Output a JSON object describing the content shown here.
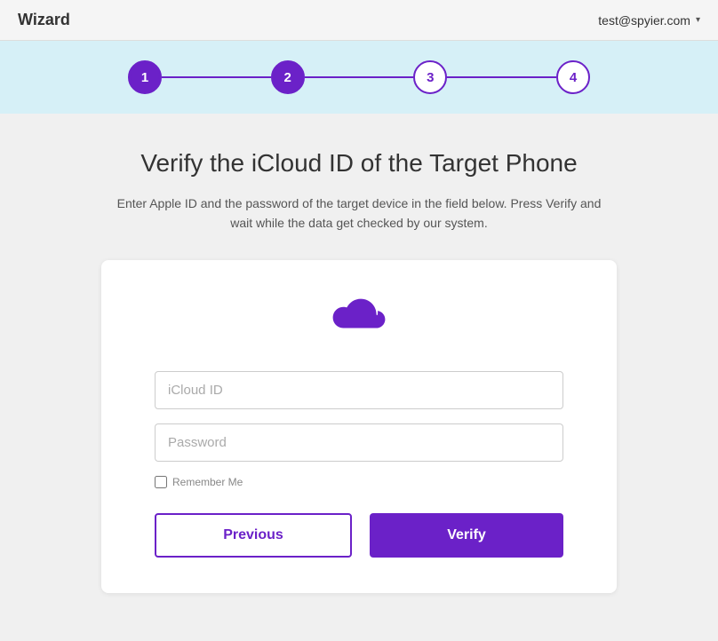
{
  "header": {
    "title": "Wizard",
    "user_email": "test@spyier.com",
    "chevron": "▾"
  },
  "stepper": {
    "steps": [
      {
        "label": "1",
        "state": "active"
      },
      {
        "label": "2",
        "state": "active"
      },
      {
        "label": "3",
        "state": "inactive"
      },
      {
        "label": "4",
        "state": "inactive"
      }
    ]
  },
  "main": {
    "title": "Verify the iCloud ID of the Target Phone",
    "description": "Enter Apple ID and the password of the target device in the field below. Press Verify and wait while the data get checked by our system.",
    "icloud_id_placeholder": "iCloud ID",
    "password_placeholder": "Password",
    "remember_label": "Remember Me",
    "btn_previous": "Previous",
    "btn_verify": "Verify"
  }
}
